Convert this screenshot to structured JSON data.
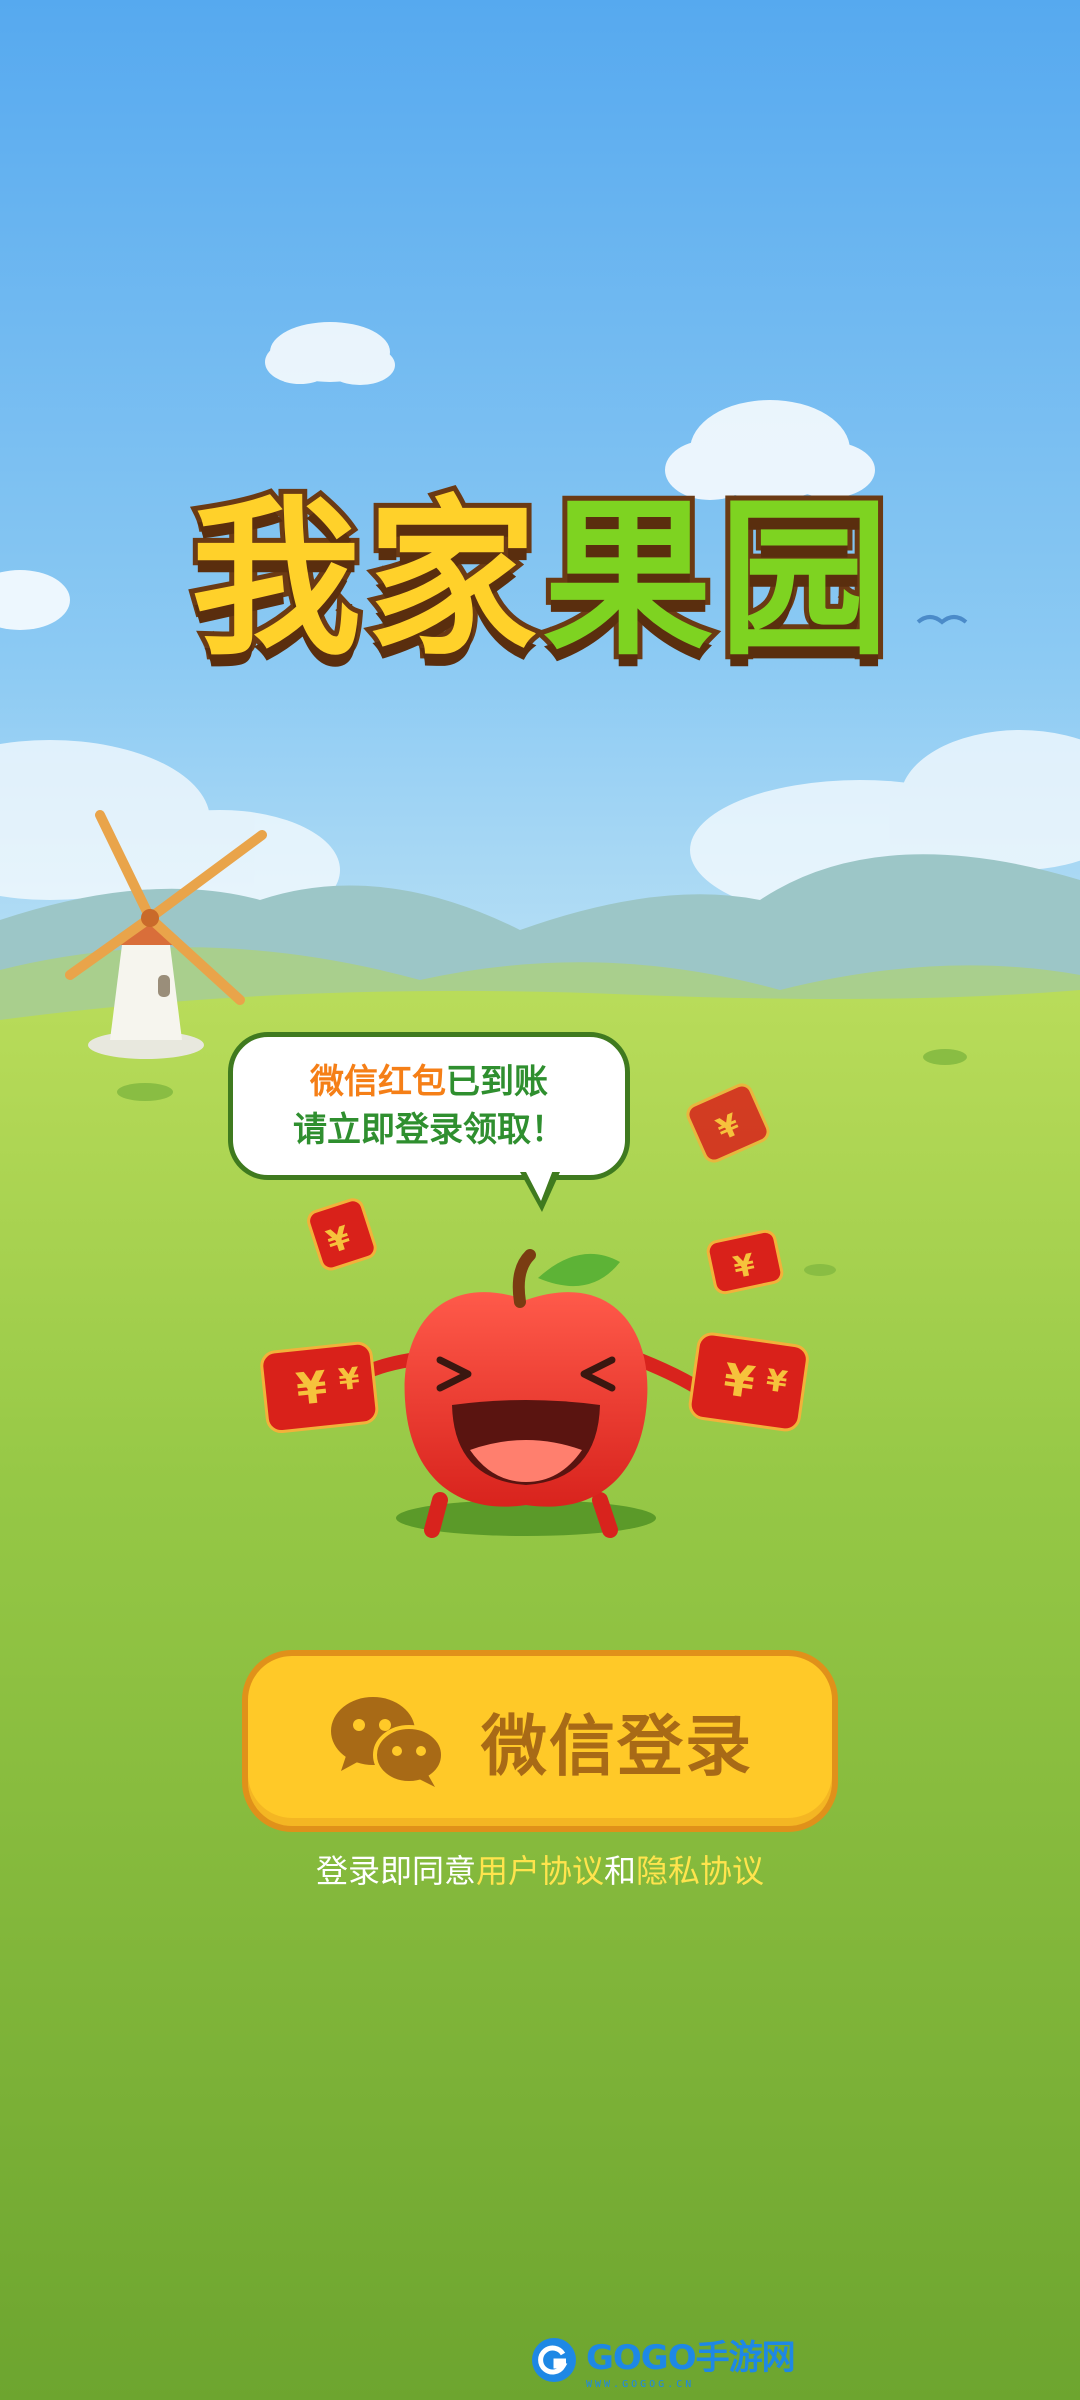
{
  "app": {
    "title_chars": [
      "我",
      "家",
      "果",
      "园"
    ]
  },
  "bubble": {
    "line1_orange": "微信红包",
    "line1_green": "已到账",
    "line2": "请立即登录领取！"
  },
  "red_packet": {
    "symbol": "¥"
  },
  "login": {
    "button_label": "微信登录"
  },
  "agreement": {
    "prefix": "登录即同意",
    "user_agreement": "用户协议",
    "and": "和",
    "privacy_policy": "隐私协议"
  },
  "watermark": {
    "text": "GOGO手游网",
    "subtext": "WWW.GOGOG.CN"
  },
  "colors": {
    "sky_top": "#56a9ef",
    "grass": "#79b53a",
    "button": "#ffc928",
    "button_border": "#e0911a",
    "link": "#ffe44d"
  }
}
